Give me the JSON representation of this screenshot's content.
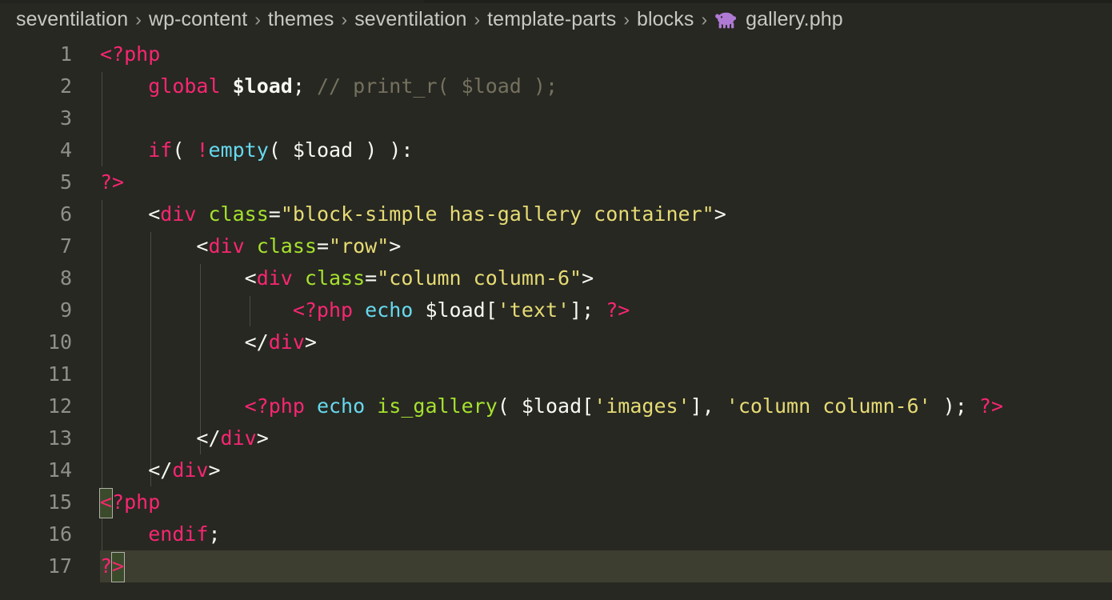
{
  "window": {
    "background_color": "#272822",
    "type": "code-editor"
  },
  "breadcrumb": {
    "separator": "›",
    "items": [
      {
        "label": "seventilation",
        "kind": "folder"
      },
      {
        "label": "wp-content",
        "kind": "folder"
      },
      {
        "label": "themes",
        "kind": "folder"
      },
      {
        "label": "seventilation",
        "kind": "folder"
      },
      {
        "label": "template-parts",
        "kind": "folder"
      },
      {
        "label": "blocks",
        "kind": "folder"
      }
    ],
    "file": {
      "label": "gallery.php",
      "icon": "php-elephant-icon",
      "icon_color": "#b07ad4"
    }
  },
  "editor": {
    "language": "php",
    "theme": "monokai",
    "active_line": 17,
    "colors": {
      "background": "#272822",
      "line_number": "#8f908a",
      "active_line_highlight": "#3e3e30",
      "indent_guide": "#4b4c45",
      "bracket_match_fill": "#3b4a2b",
      "bracket_match_border": "#b0b0a8",
      "tag": "#f92672",
      "function": "#a6e22e",
      "builtin": "#66d9ef",
      "string": "#e6db74",
      "plain": "#f8f8f2",
      "comment": "#75715e"
    },
    "line_numbers": [
      1,
      2,
      3,
      4,
      5,
      6,
      7,
      8,
      9,
      10,
      11,
      12,
      13,
      14,
      15,
      16,
      17
    ],
    "lines": [
      {
        "n": 1,
        "text": "<?php"
      },
      {
        "n": 2,
        "text": "    global $load; // print_r( $load );"
      },
      {
        "n": 3,
        "text": ""
      },
      {
        "n": 4,
        "text": "    if( !empty( $load ) ):"
      },
      {
        "n": 5,
        "text": "?>"
      },
      {
        "n": 6,
        "text": "    <div class=\"block-simple has-gallery container\">"
      },
      {
        "n": 7,
        "text": "        <div class=\"row\">"
      },
      {
        "n": 8,
        "text": "            <div class=\"column column-6\">"
      },
      {
        "n": 9,
        "text": "                <?php echo $load['text']; ?>"
      },
      {
        "n": 10,
        "text": "            </div>"
      },
      {
        "n": 11,
        "text": ""
      },
      {
        "n": 12,
        "text": "            <?php echo is_gallery( $load['images'], 'column column-6' ); ?>"
      },
      {
        "n": 13,
        "text": "        </div>"
      },
      {
        "n": 14,
        "text": "    </div>"
      },
      {
        "n": 15,
        "text": "<?php"
      },
      {
        "n": 16,
        "text": "    endif;"
      },
      {
        "n": 17,
        "text": "?>"
      }
    ]
  }
}
